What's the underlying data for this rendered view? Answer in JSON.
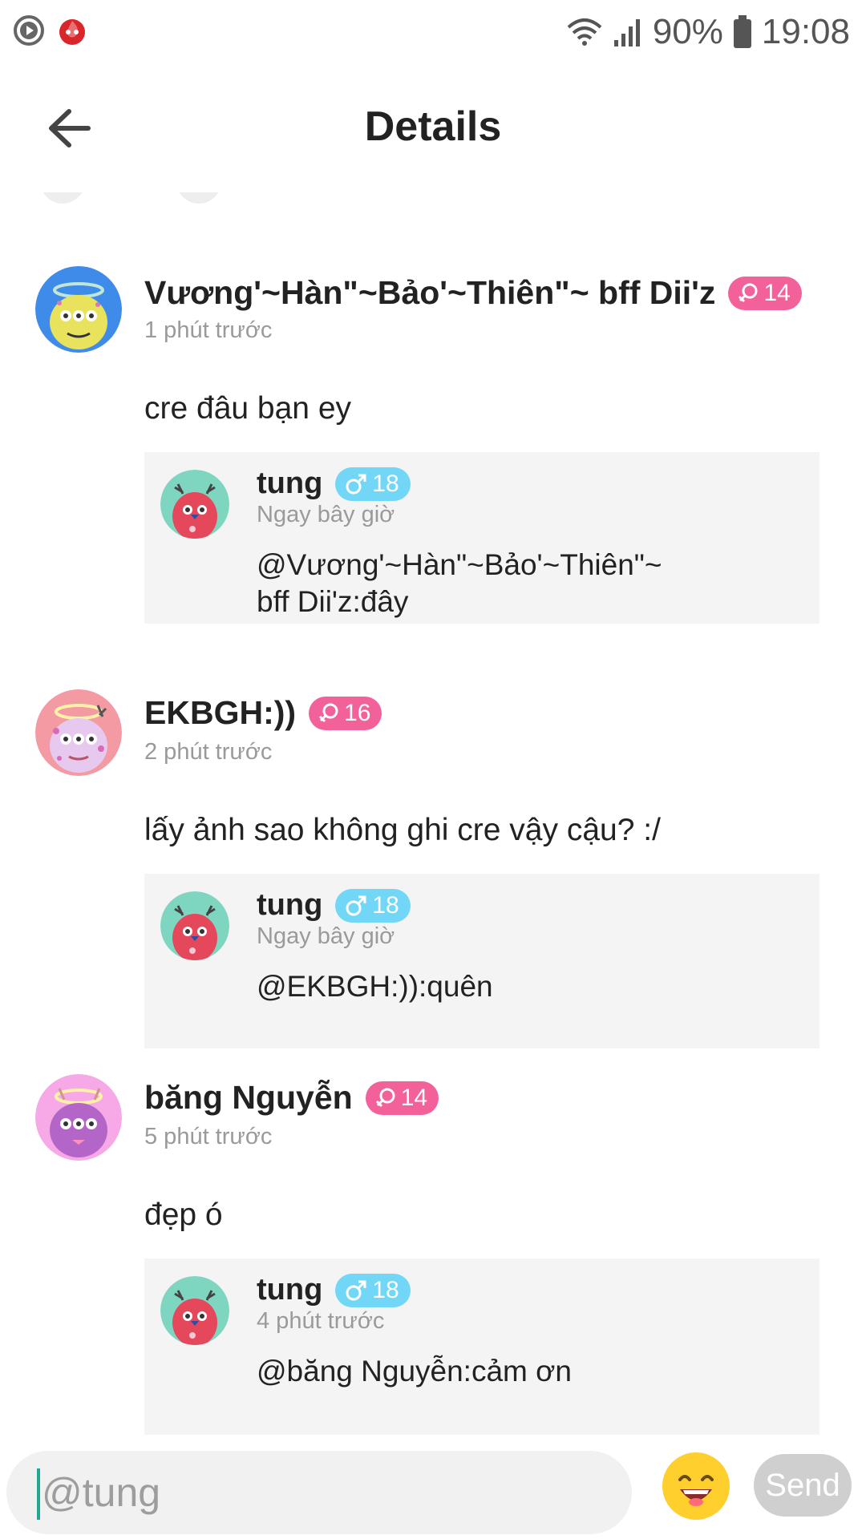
{
  "status_bar": {
    "battery": "90%",
    "time": "19:08",
    "icons": [
      "cast-icon",
      "fire-app-icon",
      "wifi-icon",
      "signal-icon",
      "battery-icon"
    ]
  },
  "header": {
    "title": "Details",
    "back_icon": "arrow-left-icon"
  },
  "comments": [
    {
      "name": "Vương'~Hàn\"~Bảo'~Thiên\"~ bff Dii'z",
      "badge": "14",
      "gender": "female",
      "time": "1 phút trước",
      "text": "cre đâu bạn ey",
      "reply": {
        "name": "tung",
        "badge": "18",
        "gender": "male",
        "time": "Ngay bây giờ",
        "text_line1": "@Vương'~Hàn\"~Bảo'~Thiên\"~",
        "text_line2": "bff Dii'z:đây"
      }
    },
    {
      "name": "EKBGH:))",
      "badge": "16",
      "gender": "female",
      "time": "2 phút trước",
      "text": "lấy ảnh sao không ghi cre vậy cậu? :/",
      "reply": {
        "name": "tung",
        "badge": "18",
        "gender": "male",
        "time": "Ngay bây giờ",
        "text_line1": "@EKBGH:)):quên",
        "text_line2": ""
      }
    },
    {
      "name": "băng Nguyễn",
      "badge": "14",
      "gender": "female",
      "time": "5 phút trước",
      "text": "đẹp ó",
      "reply": {
        "name": "tung",
        "badge": "18",
        "gender": "male",
        "time": "4 phút trước",
        "text_line1": "@băng Nguyễn:cảm ơn",
        "text_line2": ""
      }
    }
  ],
  "input": {
    "value": "@tung",
    "send_label": "Send",
    "emoji_icon": "smile-emoji-icon"
  },
  "colors": {
    "female_badge": "#f3619a",
    "male_badge": "#72d6f6",
    "caret": "#22a88f",
    "reply_bg": "#f4f4f4"
  }
}
